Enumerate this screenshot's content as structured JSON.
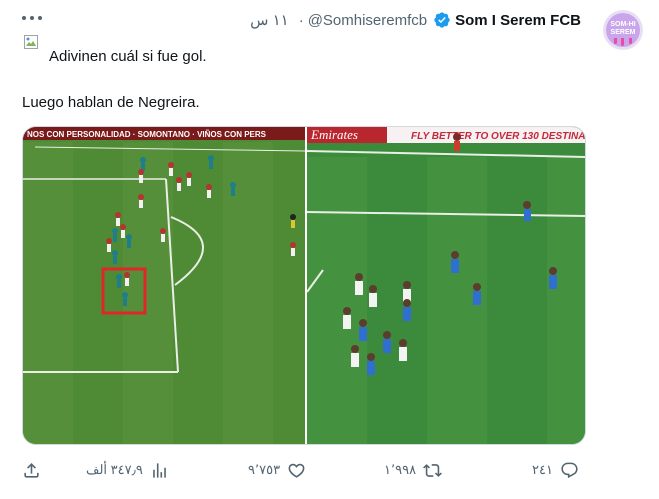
{
  "tweet": {
    "display_name": "Som I Serem FCB",
    "handle": "@Somhiseremfcb",
    "separator": "·",
    "time": "١١ س",
    "text_line1": "Adivinen cuál si fue gol.",
    "text_line2": "Luego hablan de Negreira.",
    "avatar_label": "SOM-HI SEREM"
  },
  "media": {
    "left_banner": "NOS CON PERSONALIDAD · SOMONTANO · VIÑOS CON PERS",
    "right_banner_left": "Emirates",
    "right_banner_right": "FLY BETTER TO OVER 130 DESTINA"
  },
  "actions": {
    "reply_count": "٢٤١",
    "retweet_count": "١٬٩٩٨",
    "like_count": "٩٬٧٥٣",
    "views_count": "٣٤٧٫٩ ألف"
  },
  "colors": {
    "accent": "#1d9bf0",
    "text": "#0f1419",
    "secondary": "#536471",
    "pitch_left": "#4f8a35",
    "pitch_right": "#3c8a3b",
    "highlight_box": "#e0262b"
  }
}
